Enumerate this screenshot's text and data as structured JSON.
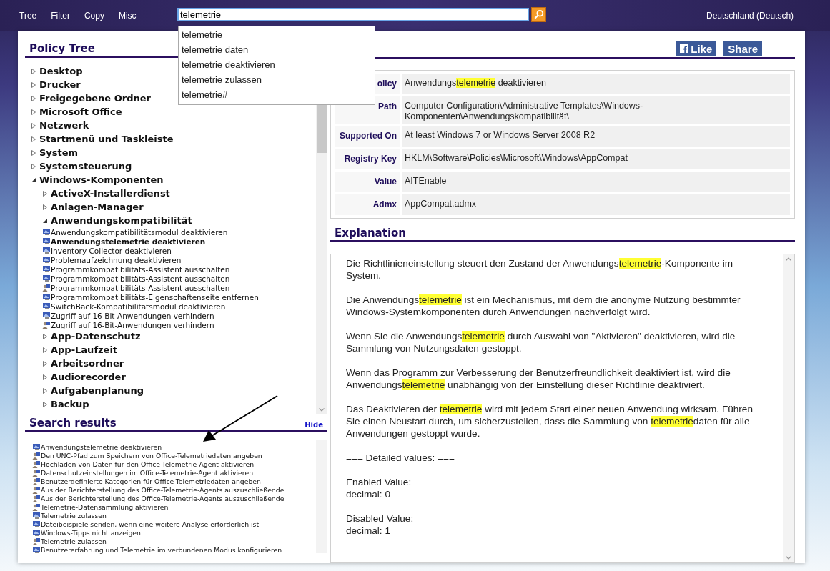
{
  "menu": [
    "Tree",
    "Filter",
    "Copy",
    "Misc"
  ],
  "search": {
    "value": "telemetrie",
    "suggestions": [
      "telemetrie",
      "telemetrie daten",
      "telemetrie deaktivieren",
      "telemetrie zulassen",
      "telemetrie#"
    ]
  },
  "language": "Deutschland (Deutsch)",
  "policy_tree": {
    "title": "Policy Tree",
    "items": [
      {
        "kind": "category",
        "label": "Desktop",
        "expanded": false
      },
      {
        "kind": "category",
        "label": "Drucker",
        "expanded": false
      },
      {
        "kind": "category",
        "label": "Freigegebene Ordner",
        "expanded": false
      },
      {
        "kind": "category",
        "label": "Microsoft Office",
        "expanded": false
      },
      {
        "kind": "category",
        "label": "Netzwerk",
        "expanded": false
      },
      {
        "kind": "category",
        "label": "Startmenü und Taskleiste",
        "expanded": false
      },
      {
        "kind": "category",
        "label": "System",
        "expanded": false
      },
      {
        "kind": "category",
        "label": "Systemsteuerung",
        "expanded": false
      },
      {
        "kind": "category",
        "label": "Windows-Komponenten",
        "expanded": true,
        "children": [
          {
            "kind": "category",
            "label": "ActiveX-Installerdienst",
            "expanded": false
          },
          {
            "kind": "category",
            "label": "Anlagen-Manager",
            "expanded": false
          },
          {
            "kind": "category",
            "label": "Anwendungskompatibilität",
            "expanded": true,
            "children": [
              {
                "kind": "computer",
                "label": "Anwendungskompatibilitätsmodul deaktivieren",
                "selected": false
              },
              {
                "kind": "computer",
                "label": "Anwendungstelemetrie deaktivieren",
                "selected": true
              },
              {
                "kind": "computer",
                "label": "Inventory Collector deaktivieren",
                "selected": false
              },
              {
                "kind": "computer",
                "label": "Problemaufzeichnung deaktivieren",
                "selected": false
              },
              {
                "kind": "computer",
                "label": "Programmkompatibilitäts-Assistent ausschalten",
                "selected": false
              },
              {
                "kind": "computer",
                "label": "Programmkompatibilitäts-Assistent ausschalten",
                "selected": false
              },
              {
                "kind": "user",
                "label": "Programmkompatibilitäts-Assistent ausschalten",
                "selected": false
              },
              {
                "kind": "computer",
                "label": "Programmkompatibilitäts-Eigenschaftenseite entfernen",
                "selected": false
              },
              {
                "kind": "computer",
                "label": "SwitchBack-Kompatibilitätsmodul deaktivieren",
                "selected": false
              },
              {
                "kind": "computer",
                "label": "Zugriff auf 16-Bit-Anwendungen verhindern",
                "selected": false
              },
              {
                "kind": "user",
                "label": "Zugriff auf 16-Bit-Anwendungen verhindern",
                "selected": false
              }
            ]
          },
          {
            "kind": "category",
            "label": "App-Datenschutz",
            "expanded": false
          },
          {
            "kind": "category",
            "label": "App-Laufzeit",
            "expanded": false
          },
          {
            "kind": "category",
            "label": "Arbeitsordner",
            "expanded": false
          },
          {
            "kind": "category",
            "label": "Audiorecorder",
            "expanded": false
          },
          {
            "kind": "category",
            "label": "Aufgabenplanung",
            "expanded": false
          },
          {
            "kind": "category",
            "label": "Backup",
            "expanded": false
          }
        ]
      }
    ]
  },
  "search_results": {
    "title": "Search results",
    "hide_link": "Hide",
    "items": [
      {
        "kind": "computer",
        "label": "Anwendungstelemetrie deaktivieren"
      },
      {
        "kind": "user",
        "label": "Den UNC-Pfad zum Speichern von Office-Telemetriedaten angeben"
      },
      {
        "kind": "user",
        "label": "Hochladen von Daten für den Office-Telemetrie-Agent aktivieren"
      },
      {
        "kind": "user",
        "label": "Datenschutzeinstellungen im Office-Telemetrie-Agent aktivieren"
      },
      {
        "kind": "user",
        "label": "Benutzerdefinierte Kategorien für Office-Telemetriedaten angeben"
      },
      {
        "kind": "user",
        "label": "Aus der Berichterstellung des Office-Telemetrie-Agents auszuschließende"
      },
      {
        "kind": "user",
        "label": "Aus der Berichterstellung des Office-Telemetrie-Agents auszuschließende"
      },
      {
        "kind": "user",
        "label": "Telemetrie-Datensammlung aktivieren"
      },
      {
        "kind": "computer",
        "label": "Telemetrie zulassen"
      },
      {
        "kind": "computer",
        "label": "Dateibeispiele senden, wenn eine weitere Analyse erforderlich ist"
      },
      {
        "kind": "computer",
        "label": "Windows-Tipps nicht anzeigen"
      },
      {
        "kind": "user",
        "label": "Telemetrie zulassen"
      },
      {
        "kind": "computer",
        "label": "Benutzererfahrung und Telemetrie im verbundenen Modus konfigurieren"
      }
    ]
  },
  "social_buttons": [
    {
      "kind": "like",
      "label": "Like"
    },
    {
      "kind": "share",
      "label": "Share"
    }
  ],
  "details": [
    {
      "label": "olicy",
      "value": [
        {
          "text": "Anwendungs",
          "highlight": false
        },
        {
          "text": "telemetrie",
          "highlight": true
        },
        {
          "text": " deaktivieren",
          "highlight": false
        }
      ]
    },
    {
      "label": "Path",
      "value": [
        {
          "text": "Computer Configuration\\Administrative Templates\\Windows-Komponenten\\Anwendungskompatibilität\\",
          "highlight": false
        }
      ]
    },
    {
      "label": "Supported On",
      "value": [
        {
          "text": "At least Windows 7 or Windows Server 2008 R2",
          "highlight": false
        }
      ]
    },
    {
      "label": "Registry Key",
      "value": [
        {
          "text": "HKLM\\Software\\Policies\\Microsoft\\Windows\\AppCompat",
          "highlight": false
        }
      ]
    },
    {
      "label": "Value",
      "value": [
        {
          "text": "AITEnable",
          "highlight": false
        }
      ]
    },
    {
      "label": "Admx",
      "value": [
        {
          "text": "AppCompat.admx",
          "highlight": false
        }
      ]
    }
  ],
  "explanation": {
    "title": "Explanation",
    "paragraphs": [
      {
        "segments": [
          {
            "text": "Die Richtlinieneinstellung steuert den Zustand der Anwendungs",
            "highlight": false
          },
          {
            "text": "telemetrie",
            "highlight": true
          },
          {
            "text": "-Komponente im System.",
            "highlight": false
          }
        ]
      },
      {
        "segments": [
          {
            "text": "Die Anwendungs",
            "highlight": false
          },
          {
            "text": "telemetrie",
            "highlight": true
          },
          {
            "text": " ist ein Mechanismus, mit dem die anonyme Nutzung bestimmter Windows-Systemkomponenten durch Anwendungen nachverfolgt wird.",
            "highlight": false
          }
        ]
      },
      {
        "segments": [
          {
            "text": "Wenn Sie die Anwendungs",
            "highlight": false
          },
          {
            "text": "telemetrie",
            "highlight": true
          },
          {
            "text": " durch Auswahl von \"Aktivieren\" deaktivieren, wird die Sammlung von Nutzungsdaten gestoppt.",
            "highlight": false
          }
        ]
      },
      {
        "segments": [
          {
            "text": "Wenn das Programm zur Verbesserung der Benutzerfreundlichkeit deaktiviert ist, wird die Anwendungs",
            "highlight": false
          },
          {
            "text": "telemetrie",
            "highlight": true
          },
          {
            "text": " unabhängig von der Einstellung dieser Richtlinie deaktiviert.",
            "highlight": false
          }
        ]
      },
      {
        "segments": [
          {
            "text": "Das Deaktivieren der ",
            "highlight": false
          },
          {
            "text": "telemetrie",
            "highlight": true
          },
          {
            "text": " wird mit jedem Start einer neuen Anwendung wirksam. Führen Sie einen Neustart durch, um sicherzustellen, dass die Sammlung von ",
            "highlight": false
          },
          {
            "text": "telemetrie",
            "highlight": true
          },
          {
            "text": "daten für alle Anwendungen gestoppt wurde.",
            "highlight": false
          }
        ]
      },
      {
        "lines": [
          "=== Detailed values: ==="
        ]
      },
      {
        "lines": [
          "Enabled Value:",
          "decimal: 0"
        ]
      },
      {
        "lines": [
          "Disabled Value:",
          "decimal: 1"
        ]
      }
    ]
  }
}
